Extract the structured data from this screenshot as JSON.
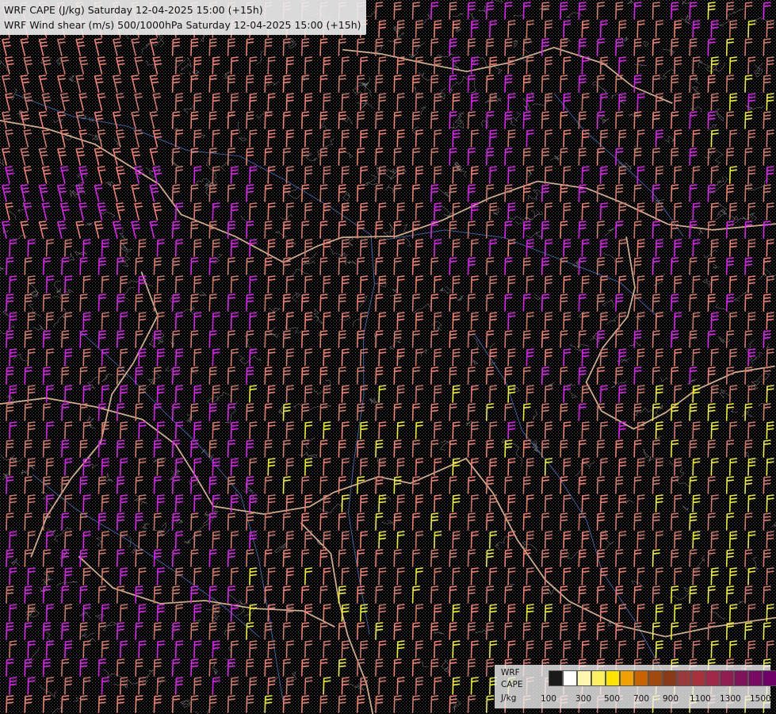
{
  "title": {
    "line1": "WRF CAPE (J/kg) Saturday 12-04-2025 15:00 (+15h)",
    "line2": "WRF Wind shear (m/s) 500/1000hPa Saturday 12-04-2025 15:00 (+15h)"
  },
  "legend": {
    "label_line1": "WRF",
    "label_line2": "CAPE",
    "label_line3": "J/kg",
    "colors": [
      "#1a1a1a",
      "#ffffff",
      "#fff6b0",
      "#fff060",
      "#ffe400",
      "#f0a000",
      "#c86400",
      "#a04a10",
      "#8a3a18",
      "#9a3a3a",
      "#a8323c",
      "#a02848",
      "#901e50",
      "#80145a",
      "#780a64",
      "#6e0068",
      "#640064"
    ],
    "tick_labels": [
      "100",
      "300",
      "500",
      "700",
      "900",
      "1100",
      "1300",
      "1500"
    ]
  },
  "map": {
    "background": "#000000",
    "barb_colors": {
      "low": "#d07a6a",
      "mid": "#f08070",
      "high": "#e020f0",
      "vhigh": "#f0f020"
    },
    "border_color": "#f2c8a0",
    "river_color": "#4a78c8",
    "terrain_contour_color": "#c0c0c0"
  }
}
